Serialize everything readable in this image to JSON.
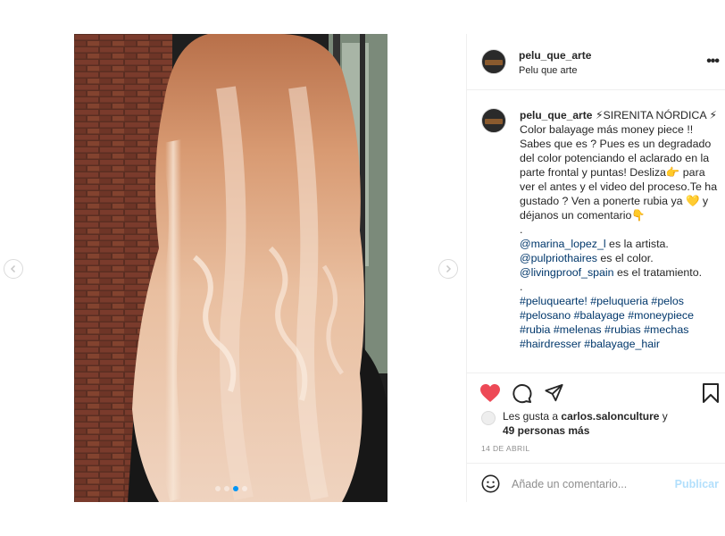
{
  "post": {
    "username": "pelu_que_arte",
    "location": "Pelu que arte",
    "more_label": "•••",
    "caption": {
      "username": "pelu_que_arte",
      "title": "⚡SIRENITA NÓRDICA ⚡",
      "body": "Color balayage más money piece !! Sabes que es ? Pues es un degradado del color potenciando el aclarado en la parte frontal y puntas! Desliza👉 para ver el antes y el video del proceso.Te ha gustado ? Ven a ponerte rubia ya 💛 y déjanos un comentario👇",
      "dot1": ".",
      "mention1": "@marina_lopez_l",
      "mention1_text": " es la artista.",
      "mention2": "@pulpriothaires",
      "mention2_text": " es el color.",
      "mention3": "@livingproof_spain",
      "mention3_text": " es el tratamiento.",
      "dot2": ".",
      "hashtags": "#peluquearte! #peluqueria #pelos #pelosano #balayage #moneypiece #rubia #melenas #rubias #mechas #hairdresser #balayage_hair"
    },
    "likes": {
      "prefix": "Les gusta a ",
      "user": "carlos.salonculture",
      "suffix": " y",
      "others": "49 personas más"
    },
    "date": "14 DE ABRIL",
    "comment_placeholder": "Añade un comentario...",
    "publish_label": "Publicar",
    "carousel": {
      "slides": 4,
      "active_index": 2
    }
  },
  "colors": {
    "like_red": "#ed4956",
    "link": "#00376b",
    "publish_disabled": "#b2dffc",
    "carousel_active": "#0095f6"
  },
  "icons": [
    "chevron-left-icon",
    "chevron-right-icon",
    "more-icon",
    "heart-icon",
    "comment-icon",
    "share-icon",
    "bookmark-icon",
    "emoji-icon"
  ]
}
